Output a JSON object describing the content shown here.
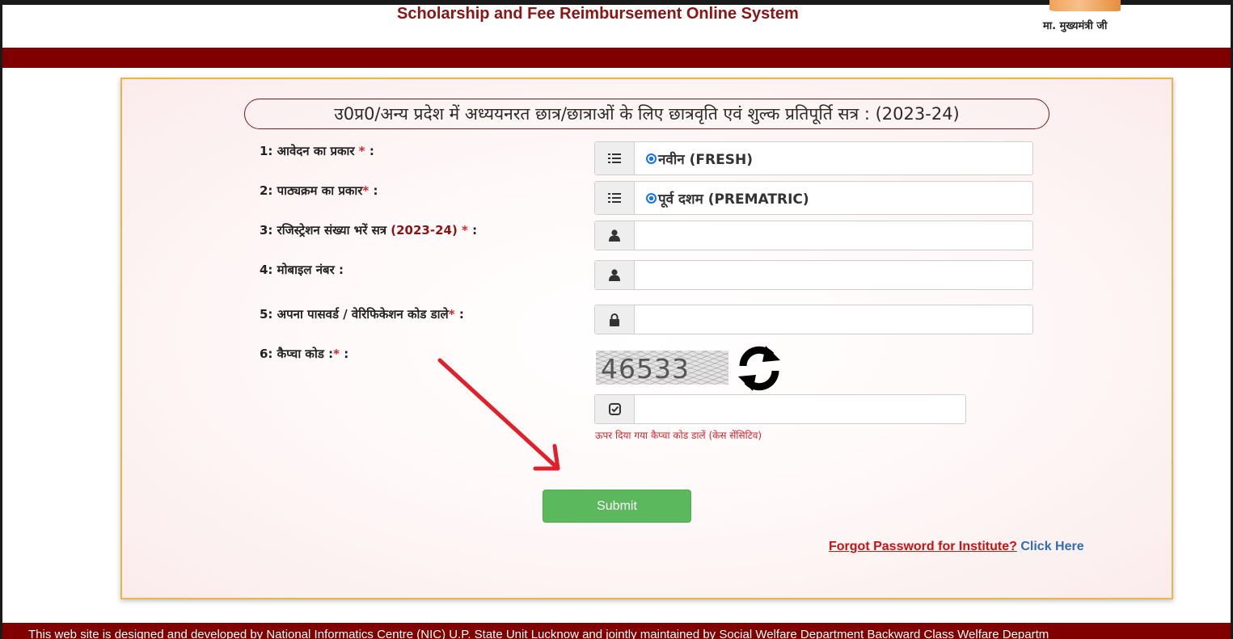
{
  "header": {
    "site_title": "Scholarship and Fee Reimbursement Online System",
    "cm_caption": "मा. मुख्यमंत्री जी"
  },
  "form": {
    "session_title": "उ0प्र0/अन्य प्रदेश में अध्ययनरत छात्र/छात्राओं के लिए छात्रवृति एवं शुल्क प्रतिपूर्ति सत्र : (2023-24)",
    "application_type_label": "1: आवेदन का प्रकार",
    "application_type_value": "नवीन (FRESH)",
    "course_type_label": "2: पाठ्यक्रम का प्रकार",
    "course_type_value": "पूर्व दशम (PREMATRIC)",
    "registration_label": "3: रजिस्ट्रेशन संख्या भरें सत्र",
    "registration_session": "(2023-24)",
    "registration_value": "",
    "mobile_label": "4: मोबाइल नंबर :",
    "mobile_value": "",
    "password_label": "5: अपना पासवर्ड / वेरिफिकेशन कोड डाले",
    "password_value": "",
    "captcha_label": "6: कैप्चा कोड :",
    "captcha_code": "46533",
    "captcha_value": "",
    "captcha_hint": "ऊपर दिया गया कैप्चा कोड डालें (केस सेंसिटिव)",
    "required_mark": "*",
    "colon": ":",
    "submit_label": "Submit",
    "forgot_text": "Forgot Password for Institute?",
    "click_here": "Click Here"
  },
  "footer": {
    "text": "This web site is designed and developed by National Informatics Centre (NIC) U.P. State Unit Lucknow and jointly maintained by Social Welfare Department Backward Class Welfare Departm"
  },
  "colors": {
    "brand_maroon": "#800000",
    "panel_border": "#e9b54d",
    "submit_green": "#5cb85c",
    "required_red": "#d9232d",
    "link_blue": "#2f6fb6"
  },
  "icons": {
    "list": "list-icon",
    "user": "user-icon",
    "lock": "lock-icon",
    "check": "check-square-icon",
    "refresh": "refresh-icon",
    "arrow": "red-arrow-annotation"
  }
}
